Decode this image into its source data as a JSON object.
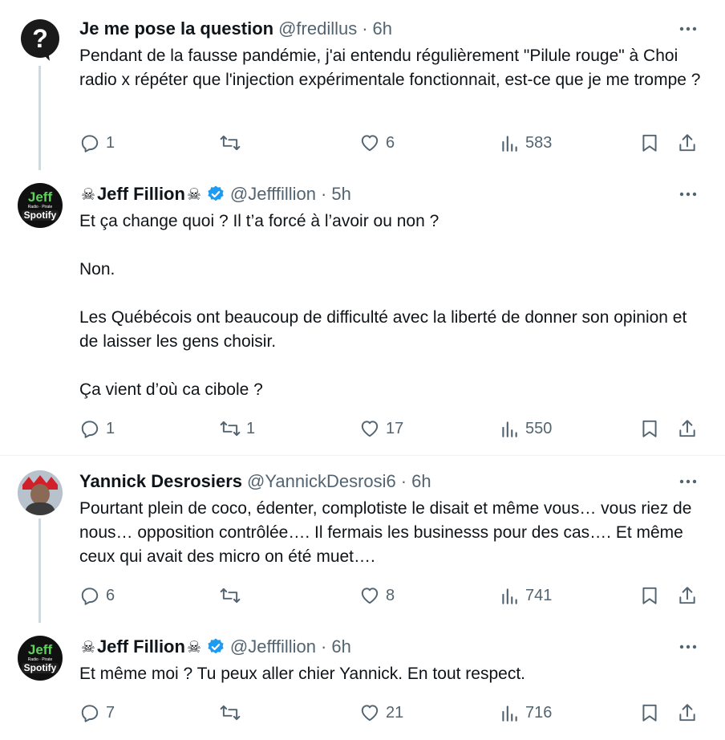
{
  "tweets": [
    {
      "name": "Je me pose la question",
      "handle": "@fredillus",
      "time": "6h",
      "text": [
        "Pendant de la fausse pandémie, j'ai entendu régulièrement \"Pilule rouge\" à Choi radio x répéter que l'injection expérimentale fonctionnait, est-ce que je me trompe ?"
      ],
      "replies": "1",
      "retweets": "",
      "likes": "6",
      "views": "583"
    },
    {
      "name": "Jeff Fillion",
      "handle": "@Jefffillion",
      "time": "5h",
      "text": [
        "Et ça change quoi ? Il t’a forcé à l’avoir ou non ?",
        "Non.",
        "Les Québécois ont beaucoup de difficulté avec la liberté de donner son opinion et de laisser les gens choisir.",
        "Ça vient d’où ca cibole ?"
      ],
      "replies": "1",
      "retweets": "1",
      "likes": "17",
      "views": "550"
    },
    {
      "name": "Yannick Desrosiers",
      "handle": "@YannickDesrosi6",
      "time": "6h",
      "text": [
        "Pourtant plein de coco, édenter, complotiste le disait et même vous… vous riez de nous… opposition contrôlée…. Il fermais les businesss pour des cas…. Et même ceux qui avait des micro on été muet…."
      ],
      "replies": "6",
      "retweets": "",
      "likes": "8",
      "views": "741"
    },
    {
      "name": "Jeff Fillion",
      "handle": "@Jefffillion",
      "time": "6h",
      "text": [
        "Et même moi ? Tu peux aller chier Yannick. En tout respect."
      ],
      "replies": "7",
      "retweets": "",
      "likes": "21",
      "views": "716"
    }
  ],
  "avatar_jeff": {
    "top": "Jeff",
    "mid": "Radio · Pirate",
    "bottom": "Spotify"
  },
  "avatar_question": "?",
  "colors": {
    "text": "#0f1419",
    "secondary": "#536471",
    "verified": "#1d9bf0",
    "thread_line": "#cfd9de"
  }
}
